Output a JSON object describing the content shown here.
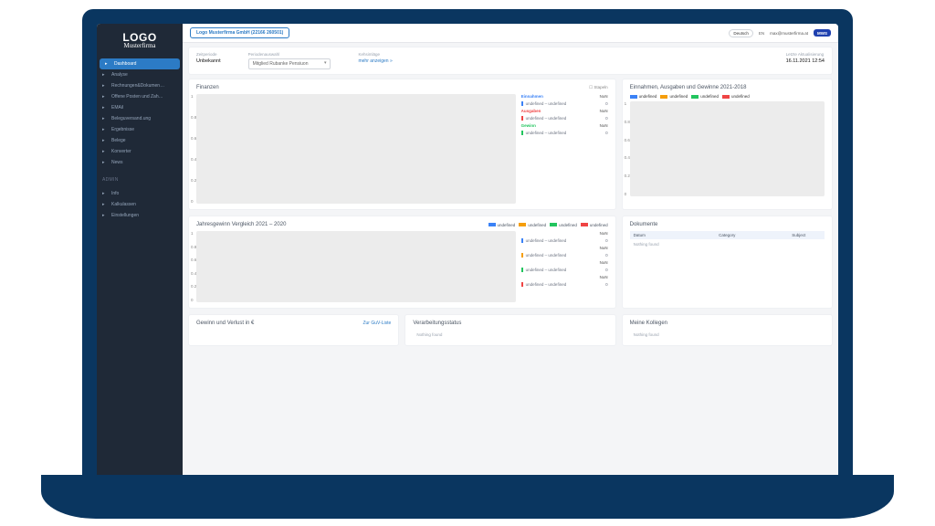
{
  "brand": {
    "logo": "LOGO",
    "tagline": "Musterfirma"
  },
  "sidebar": {
    "items": [
      {
        "icon": "grid",
        "label": "Dashboard",
        "active": true
      },
      {
        "icon": "chart",
        "label": "Analyse"
      },
      {
        "icon": "doc",
        "label": "Rechnungen&Dokumen…"
      },
      {
        "icon": "list",
        "label": "Offene Posten und Zah…"
      },
      {
        "icon": "mail",
        "label": "EMAil"
      },
      {
        "icon": "bars",
        "label": "Beleguversand.ung"
      },
      {
        "icon": "check",
        "label": "Ergebnisse"
      },
      {
        "icon": "file",
        "label": "Belege"
      },
      {
        "icon": "tool",
        "label": "Konverter"
      },
      {
        "icon": "news",
        "label": "News"
      }
    ],
    "adminLabel": "ADMIN",
    "admin": [
      {
        "icon": "info",
        "label": "Info"
      },
      {
        "icon": "calc",
        "label": "Kalkulassen"
      },
      {
        "icon": "gear",
        "label": "Einstellungen"
      }
    ]
  },
  "topbar": {
    "company": "Logo Musterfirma GmbH (22166 260501)",
    "lang": "Deutsch",
    "langShort": "EN",
    "userEmail": "max@musterfirma.at",
    "userBadge": "MWS"
  },
  "filters": {
    "periodLabel": "Zeitperiode",
    "periodValue": "Unbekannt",
    "selectLabel": "Periodenauswahl",
    "selectValue": "Mitglied Rubanke Pensiuon",
    "amountsLabel": "Kehsimläge",
    "amountsLink": "mehr anzeigen »",
    "updatedLabel": "Letzte Aktualisierung",
    "updatedValue": "16.11.2021 12:54"
  },
  "colors": {
    "blue": "#3b82f6",
    "orange": "#f59e0b",
    "green": "#22c55e",
    "red": "#ef4444"
  },
  "legendWord": "undefined",
  "nanWord": "NaN",
  "zeroWord": "0",
  "undefPair": "undefined – undefined",
  "cards": {
    "finanzen": {
      "title": "Finanzen",
      "stapelnLabel": "Stapeln",
      "groups": [
        {
          "title": "Einnahmen",
          "color": "#3b82f6"
        },
        {
          "title": "Ausgaben",
          "color": "#ef4444"
        },
        {
          "title": "Gewinn",
          "color": "#22c55e"
        }
      ]
    },
    "einnahmen": {
      "title": "Einnahmen, Ausgaben und Gewinne 2021-2018"
    },
    "vergleich": {
      "title": "Jahresgewinn Vergleich 2021 – 2020",
      "rows": 4
    },
    "dokumente": {
      "title": "Dokumente",
      "cols": [
        "Datum",
        "Category",
        "Subject"
      ],
      "empty": "Nothing found"
    },
    "guv": {
      "title": "Gewinn und Verlust in €",
      "link": "Zur GuV-Liste"
    },
    "status": {
      "title": "Verarbeitungsstatus",
      "empty": "Nothing found"
    },
    "kollegen": {
      "title": "Meine Kollegen",
      "empty": "Nothing found"
    }
  },
  "chart_data": [
    {
      "type": "bar",
      "title": "Finanzen",
      "series": [
        {
          "name": "undefined",
          "values": []
        }
      ],
      "ylim": [
        0,
        1
      ],
      "yticks": [
        1,
        0.8,
        0.6,
        0.4,
        0.2,
        0
      ]
    },
    {
      "type": "bar",
      "title": "Einnahmen, Ausgaben und Gewinne 2021-2018",
      "categories": [],
      "series": [
        {
          "name": "undefined",
          "color": "#3b82f6",
          "values": []
        },
        {
          "name": "undefined",
          "color": "#f59e0b",
          "values": []
        },
        {
          "name": "undefined",
          "color": "#22c55e",
          "values": []
        },
        {
          "name": "undefined",
          "color": "#ef4444",
          "values": []
        }
      ],
      "ylim": [
        0,
        1
      ],
      "yticks": [
        1,
        0.8,
        0.6,
        0.4,
        0.2,
        0
      ]
    },
    {
      "type": "bar",
      "title": "Jahresgewinn Vergleich 2021 – 2020",
      "categories": [],
      "series": [
        {
          "name": "undefined",
          "color": "#3b82f6",
          "values": []
        },
        {
          "name": "undefined",
          "color": "#f59e0b",
          "values": []
        },
        {
          "name": "undefined",
          "color": "#22c55e",
          "values": []
        },
        {
          "name": "undefined",
          "color": "#ef4444",
          "values": []
        }
      ],
      "ylim": [
        0,
        1
      ],
      "yticks": [
        1,
        0.8,
        0.6,
        0.4,
        0.2,
        0
      ]
    }
  ]
}
